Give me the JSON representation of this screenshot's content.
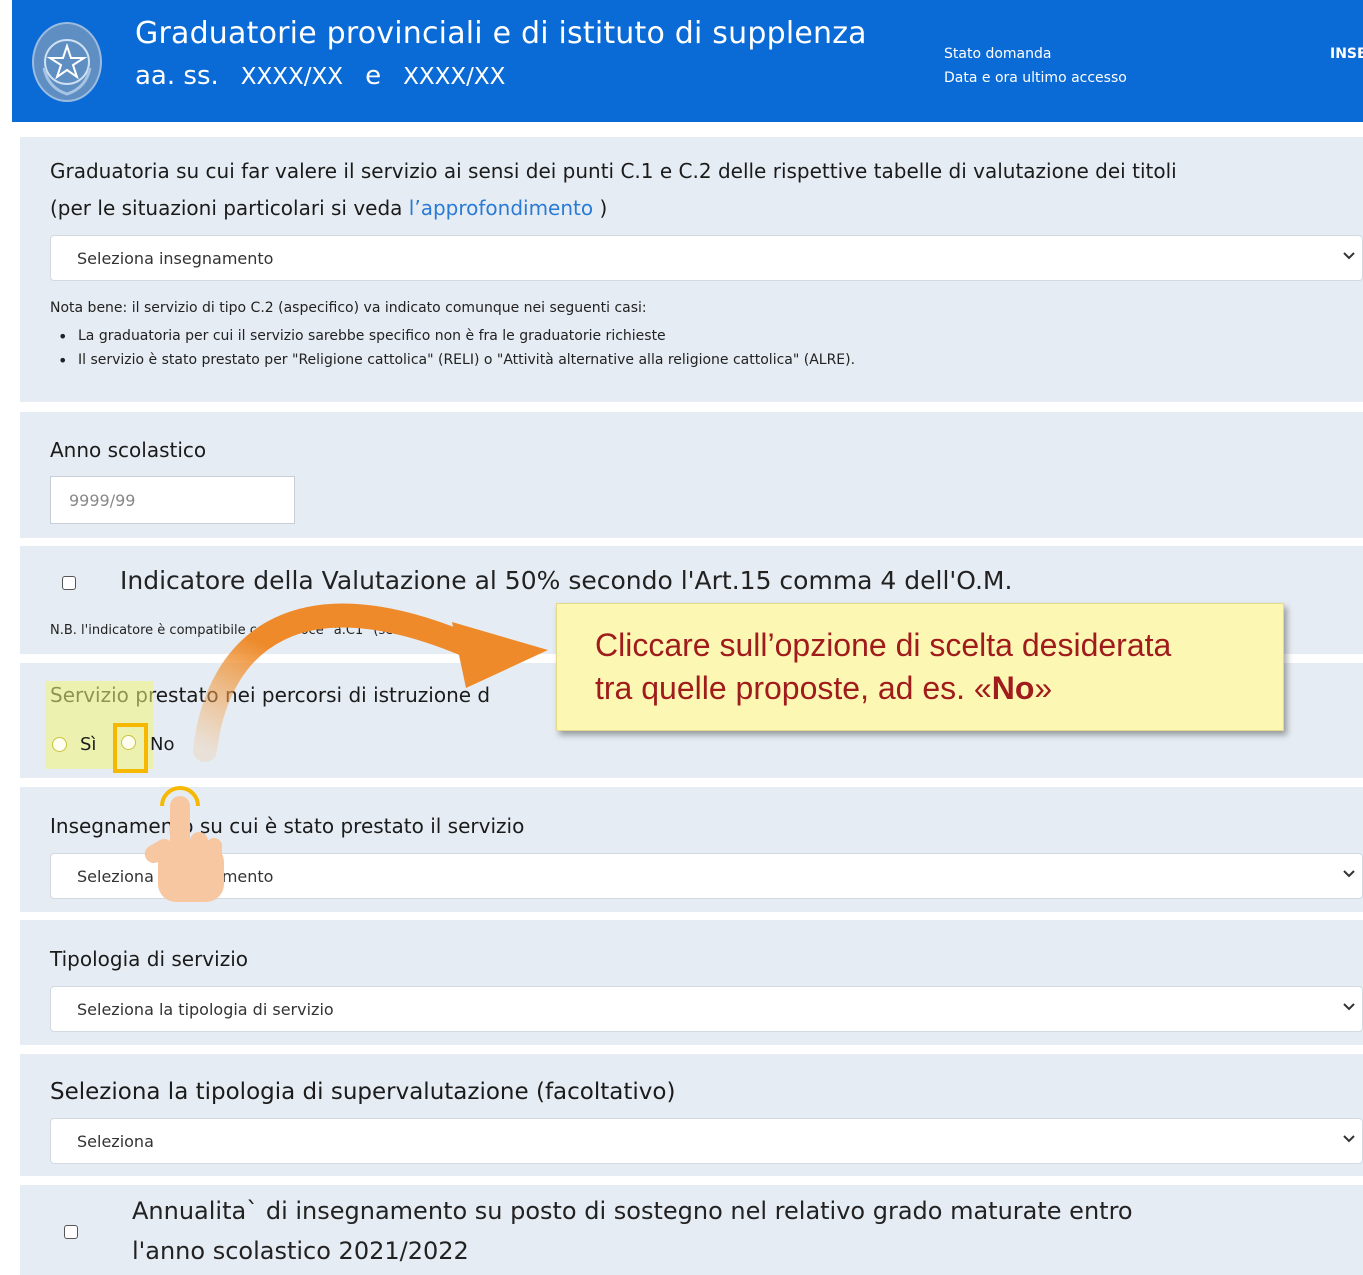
{
  "header": {
    "title": "Graduatorie provinciali e di istituto di supplenza",
    "subtitle_prefix": "aa. ss.",
    "year_a": "XXXX/XX",
    "joiner": "e",
    "year_b": "XXXX/XX",
    "status_label": "Stato domanda",
    "last_access_label": "Data e ora ultimo accesso",
    "status_value": "INSERIT"
  },
  "graduatoria": {
    "label_line1": "Graduatoria su cui far valere il servizio ai sensi dei punti C.1 e C.2 delle rispettive tabelle di valutazione dei titoli",
    "label_line2_prefix": "(per le situazioni particolari si veda ",
    "link_text": "l’approfondimento",
    "label_line2_suffix": " )",
    "select_value": "Seleziona insegnamento",
    "note": "Nota bene: il servizio di tipo C.2 (aspecifico) va indicato comunque nei seguenti casi:",
    "bullets": [
      "La graduatoria per cui il servizio sarebbe specifico non è fra le graduatorie richieste",
      "Il servizio è stato prestato per \"Religione cattolica\" (RELI) o \"Attività alternative alla religione cattolica\" (ALRE)."
    ]
  },
  "anno": {
    "label": "Anno scolastico",
    "placeholder": "9999/99"
  },
  "indicatore": {
    "label": "Indicatore della Valutazione al 50% secondo l'Art.15 comma 4 dell'O.M.",
    "note": "N.B. l'indicatore è compatibile con la voce \"a.C1\" (servizio s"
  },
  "servizio": {
    "label": "Servizio prestato nei percorsi di istruzione d",
    "options": [
      "Sì",
      "No"
    ]
  },
  "insegnamento": {
    "label": "Insegnamento su cui è stato prestato il servizio",
    "select_value": "Seleziona insegnamento"
  },
  "tipologia": {
    "label": "Tipologia di servizio",
    "select_value": "Seleziona la tipologia di servizio"
  },
  "supervalutazione": {
    "label": "Seleziona la tipologia di supervalutazione (facoltativo)",
    "select_value": "Seleziona"
  },
  "annualita": {
    "line1": "Annualita` di insegnamento su posto di sostegno nel relativo grado maturate entro",
    "line2": "l'anno scolastico 2021/2022"
  },
  "callout": {
    "line1": "Cliccare sull’opzione di scelta desiderata",
    "line2_prefix": "tra quelle proposte, ad es. «",
    "line2_bold": "No",
    "line2_suffix": "»"
  },
  "icons": {
    "dropdown": "chevron-down-icon",
    "emblem": "italian-republic-emblem-icon",
    "pointer": "hand-pointer-icon",
    "arrow": "curved-arrow-icon"
  },
  "colors": {
    "header_bg": "#0a6ad6",
    "section_bg": "#e6ecf3",
    "link": "#2a7bd6",
    "callout_bg": "#fdf7b4",
    "callout_text": "#a01c1c",
    "highlight_border": "#f6b800",
    "arrow": "#ee8a2a"
  }
}
